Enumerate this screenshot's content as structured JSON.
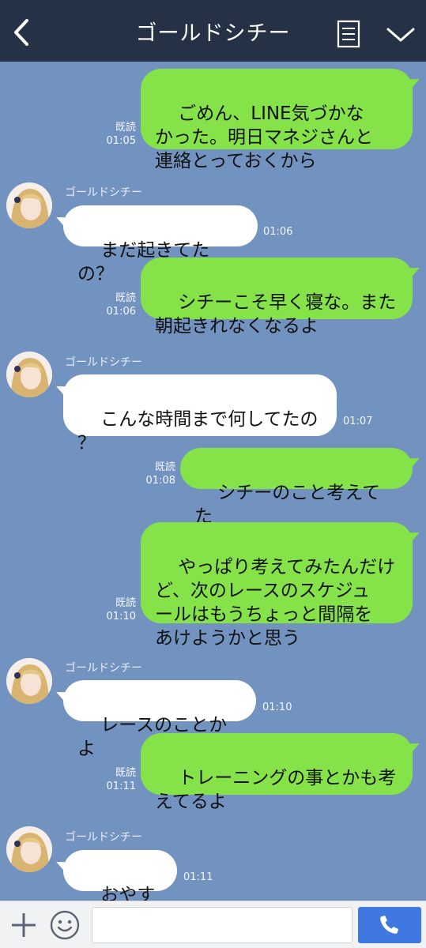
{
  "header": {
    "title": "ゴールドシチー",
    "back_icon": "chevron-left-icon",
    "menu_icon": "document-list-icon",
    "more_icon": "chevron-down-icon"
  },
  "messages": [
    {
      "type": "sent",
      "text": "ごめん、LINE気づかな\nかった。明日マネジさんと\n連絡とっておくから",
      "read": "既読",
      "time": "01:05"
    },
    {
      "type": "recv",
      "sender": "ゴールドシチー",
      "text": "まだ起きてたの？",
      "time": "01:06"
    },
    {
      "type": "sent",
      "text": "シチーこそ早く寝な。また\n朝起きれなくなるよ",
      "read": "既読",
      "time": "01:06"
    },
    {
      "type": "recv",
      "sender": "ゴールドシチー",
      "text": "こんな時間まで何してたの\n？",
      "time": "01:07"
    },
    {
      "type": "sent",
      "text": "シチーのこと考えてた",
      "read": "既読",
      "time": "01:08"
    },
    {
      "type": "sent",
      "text": "やっぱり考えてみたんだけ\nど、次のレースのスケジュ\nールはもうちょっと間隔を\nあけようかと思う",
      "read": "既読",
      "time": "01:10"
    },
    {
      "type": "recv",
      "sender": "ゴールドシチー",
      "text": "レースのことかよ",
      "time": "01:10"
    },
    {
      "type": "sent",
      "text": "トレーニングの事とかも考\nえてるよ",
      "read": "既読",
      "time": "01:11"
    },
    {
      "type": "recv",
      "sender": "ゴールドシチー",
      "text": "おやすみ",
      "time": "01:11"
    }
  ],
  "footer": {
    "input_value": "",
    "plus_icon": "plus-icon",
    "emoji_icon": "smiley-icon",
    "call_icon": "phone-icon"
  },
  "colors": {
    "header_bg": "#253245",
    "chat_bg": "#7293c0",
    "sent_bubble": "#85e249",
    "recv_bubble": "#ffffff",
    "call_button": "#3f78e0"
  }
}
